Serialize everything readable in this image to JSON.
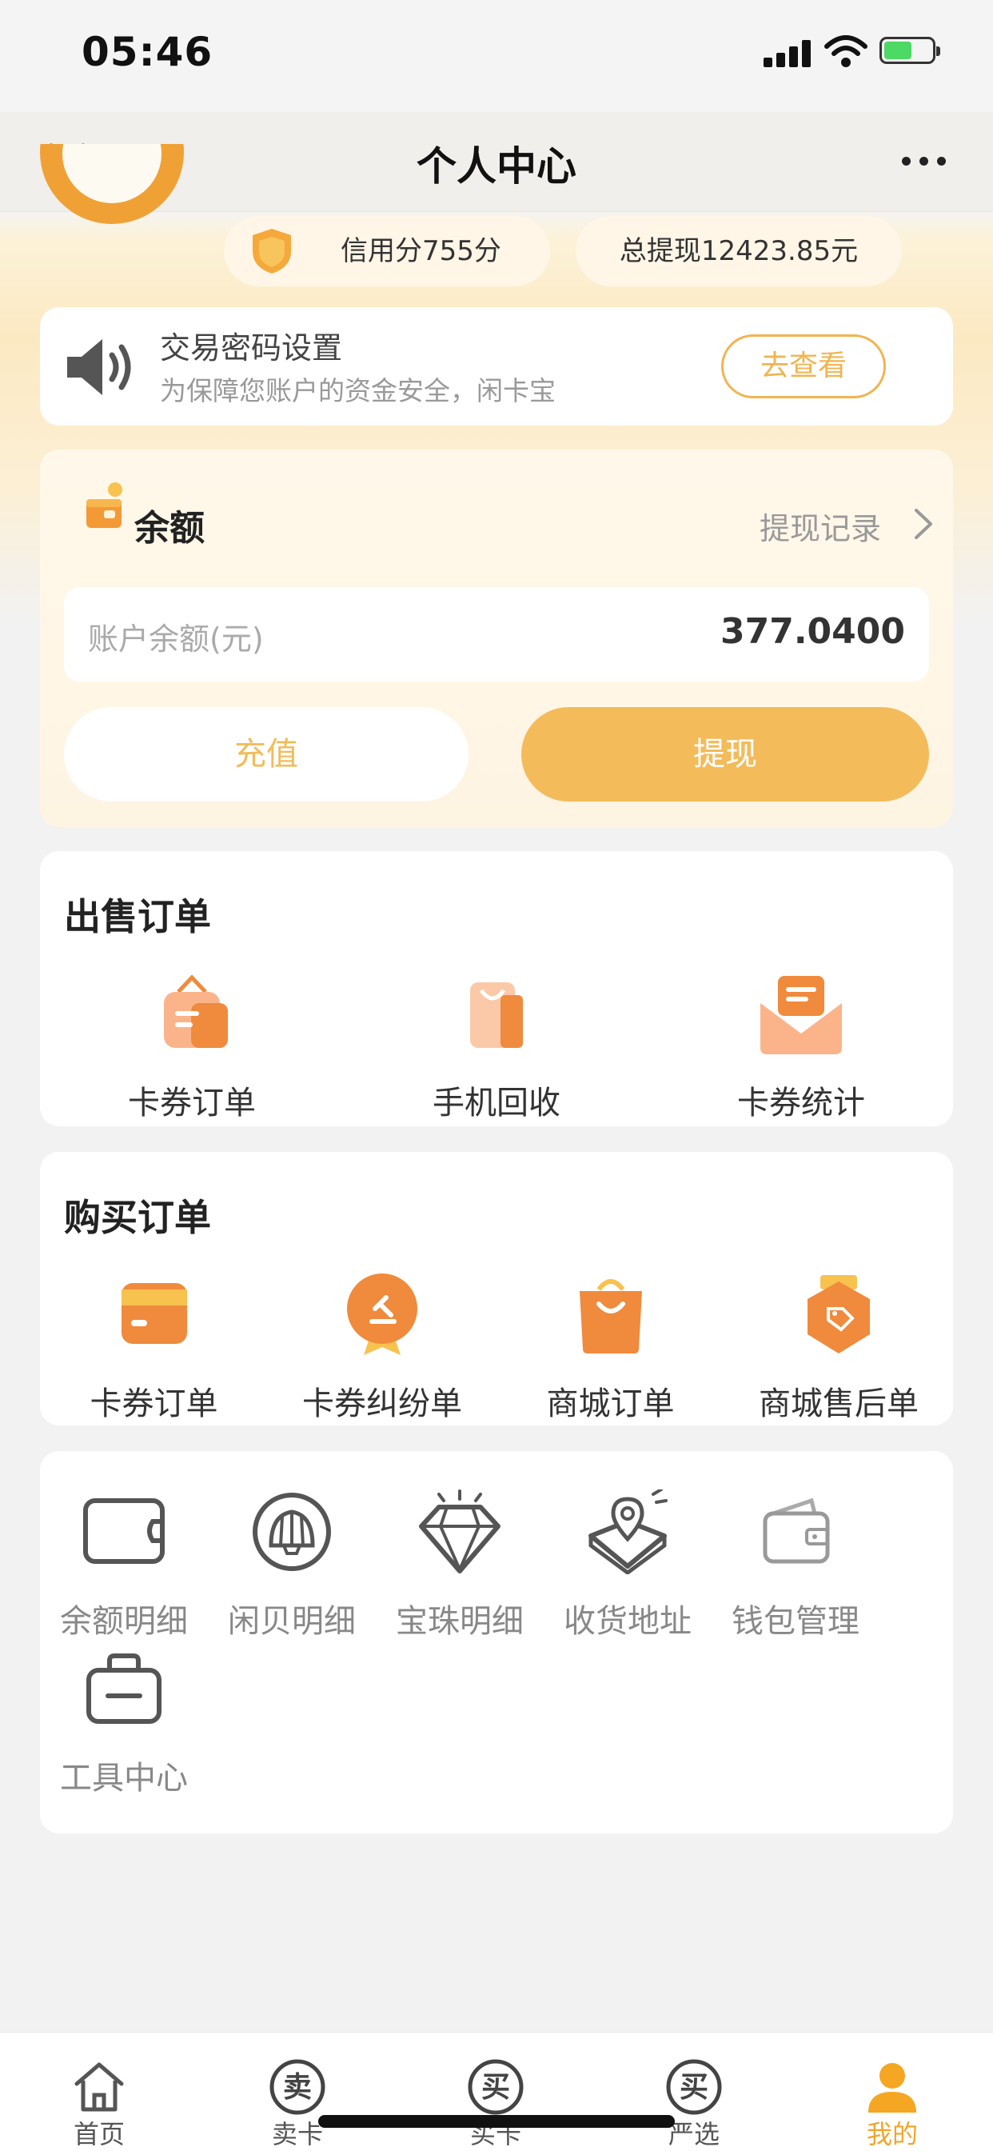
{
  "status_bar": {
    "time": "05:46"
  },
  "nav": {
    "title": "个人中心"
  },
  "profile": {
    "credit": "信用分755分",
    "total_withdraw": "总提现12423.85元"
  },
  "notice": {
    "title": "交易密码设置",
    "desc": "为保障您账户的资金安全，闲卡宝",
    "button": "去查看"
  },
  "balance": {
    "title": "余额",
    "record_link": "提现记录",
    "label": "账户余额(元)",
    "amount": "377.0400",
    "recharge": "充值",
    "withdraw": "提现"
  },
  "sell_orders": {
    "title": "出售订单",
    "items": [
      "卡券订单",
      "手机回收",
      "卡券统计"
    ]
  },
  "buy_orders": {
    "title": "购买订单",
    "items": [
      "卡券订单",
      "卡券纠纷单",
      "商城订单",
      "商城售后单"
    ]
  },
  "tools": {
    "items": [
      "余额明细",
      "闲贝明细",
      "宝珠明细",
      "收货地址",
      "钱包管理",
      "工具中心"
    ]
  },
  "tabbar": {
    "items": [
      "首页",
      "卖卡",
      "买卡",
      "严选",
      "我的"
    ],
    "active": "我的",
    "badge_chars": [
      "卖",
      "买",
      "买"
    ]
  },
  "colors": {
    "accent": "#f3bb5a",
    "accent_dark": "#f0a135",
    "icon_orange": "#f08a3c"
  }
}
